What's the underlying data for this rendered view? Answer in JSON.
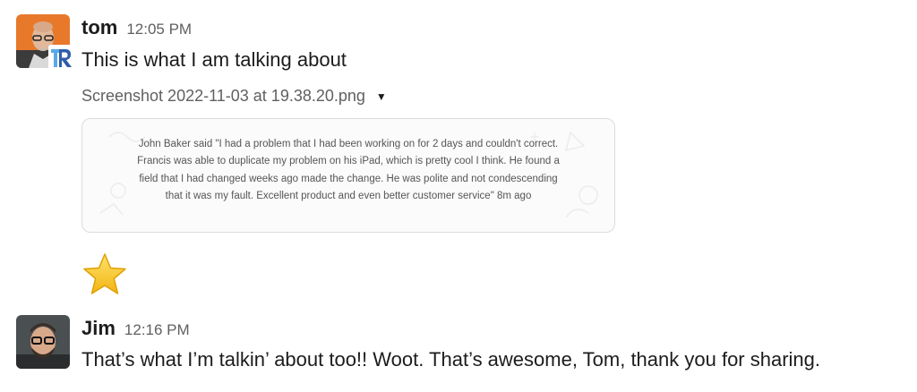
{
  "messages": [
    {
      "author": "tom",
      "time": "12:05 PM",
      "text": "This is what I am talking about",
      "badge": "R",
      "attachment": {
        "filename": "Screenshot 2022-11-03 at 19.38.20.png",
        "caret_icon": "caret-down-icon",
        "preview_text": "John Baker said \"I had a problem that I had been working on for 2 days and couldn't correct. Francis was able to duplicate my problem on his iPad, which is pretty cool I think. He found a field that I had changed weeks ago made the change. He was polite and not condescending that it was my fault. Excellent product and even better customer service\" 8m ago"
      },
      "reaction": {
        "emoji": "star-icon"
      }
    },
    {
      "author": "Jim",
      "time": "12:16 PM",
      "text": "That’s what I’m talkin’ about too!! Woot. That’s awesome, Tom, thank you for sharing."
    }
  ],
  "colors": {
    "text": "#1d1c1d",
    "muted": "#616061",
    "tom_avatar_bg": "#e8792b",
    "badge_blue": "#2f5da8",
    "star": "#f5c518"
  }
}
